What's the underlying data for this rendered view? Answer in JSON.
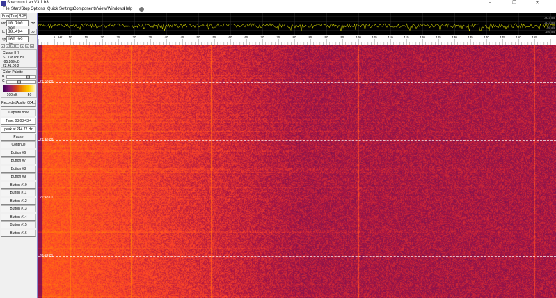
{
  "window": {
    "title": "Spectrum Lab V3.1 b3",
    "minimize": "–",
    "restore": "❐",
    "close": "✕"
  },
  "menu": [
    "File",
    "Start/Stop",
    "Options",
    "Quick Settings",
    "Components",
    "View/Windows",
    "Help"
  ],
  "left": {
    "tabs": [
      "Freq",
      "Time",
      "RDF"
    ],
    "vfo_label": "vfo",
    "vfo_value": "10 700 000",
    "vfo_unit": "Hz",
    "fc_label": "fc",
    "fc_value": "80.494 Hz",
    "fc_btn": "opt",
    "sp_label": "sp",
    "sp_value": "160.99 Hz",
    "arrows": [
      "«",
      "‹",
      "‹",
      "-",
      "+",
      "›",
      "»"
    ],
    "cursor": {
      "title": "Cursor [H]",
      "freq": "67.798186 Hz",
      "level": "-95.269 dB",
      "time": "22:41:08.2"
    },
    "palette": {
      "title": "Color Palette",
      "b": "B",
      "c": "C",
      "b_level": 0.75,
      "c_level": 0.4,
      "min": "-100 dB",
      "max": "-50"
    },
    "buttons": [
      "RecordedAudio_004...",
      "Capture now",
      "Time:  03:03:43.4",
      "peak at 244.72 Hz",
      "Pause",
      "Continue",
      "Button #6",
      "Button #7",
      "Button #8",
      "Button #9",
      "Button #10",
      "Button #11",
      "Button #12",
      "Button #13",
      "Button #14",
      "Button #15",
      "Button #16"
    ]
  },
  "spectrum": {
    "db_labels": [
      "-60.0 dB",
      "-80.0 dB",
      "-90 dB",
      "-100 dB"
    ],
    "trace_color": "#c8c800"
  },
  "scale": {
    "unit": "Hz",
    "labels": [
      "5",
      "10",
      "15",
      "20",
      "25",
      "30",
      "35",
      "40",
      "45",
      "50",
      "55",
      "60",
      "65",
      "70",
      "75",
      "80",
      "85",
      "90",
      "95",
      "100",
      "105",
      "110",
      "115",
      "120",
      "125",
      "130",
      "135",
      "140",
      "145",
      "150",
      "155"
    ]
  },
  "waterfall": {
    "timestamps": [
      "22:50:08",
      "22:45:08",
      "22:48:01",
      "22:38:01"
    ]
  }
}
